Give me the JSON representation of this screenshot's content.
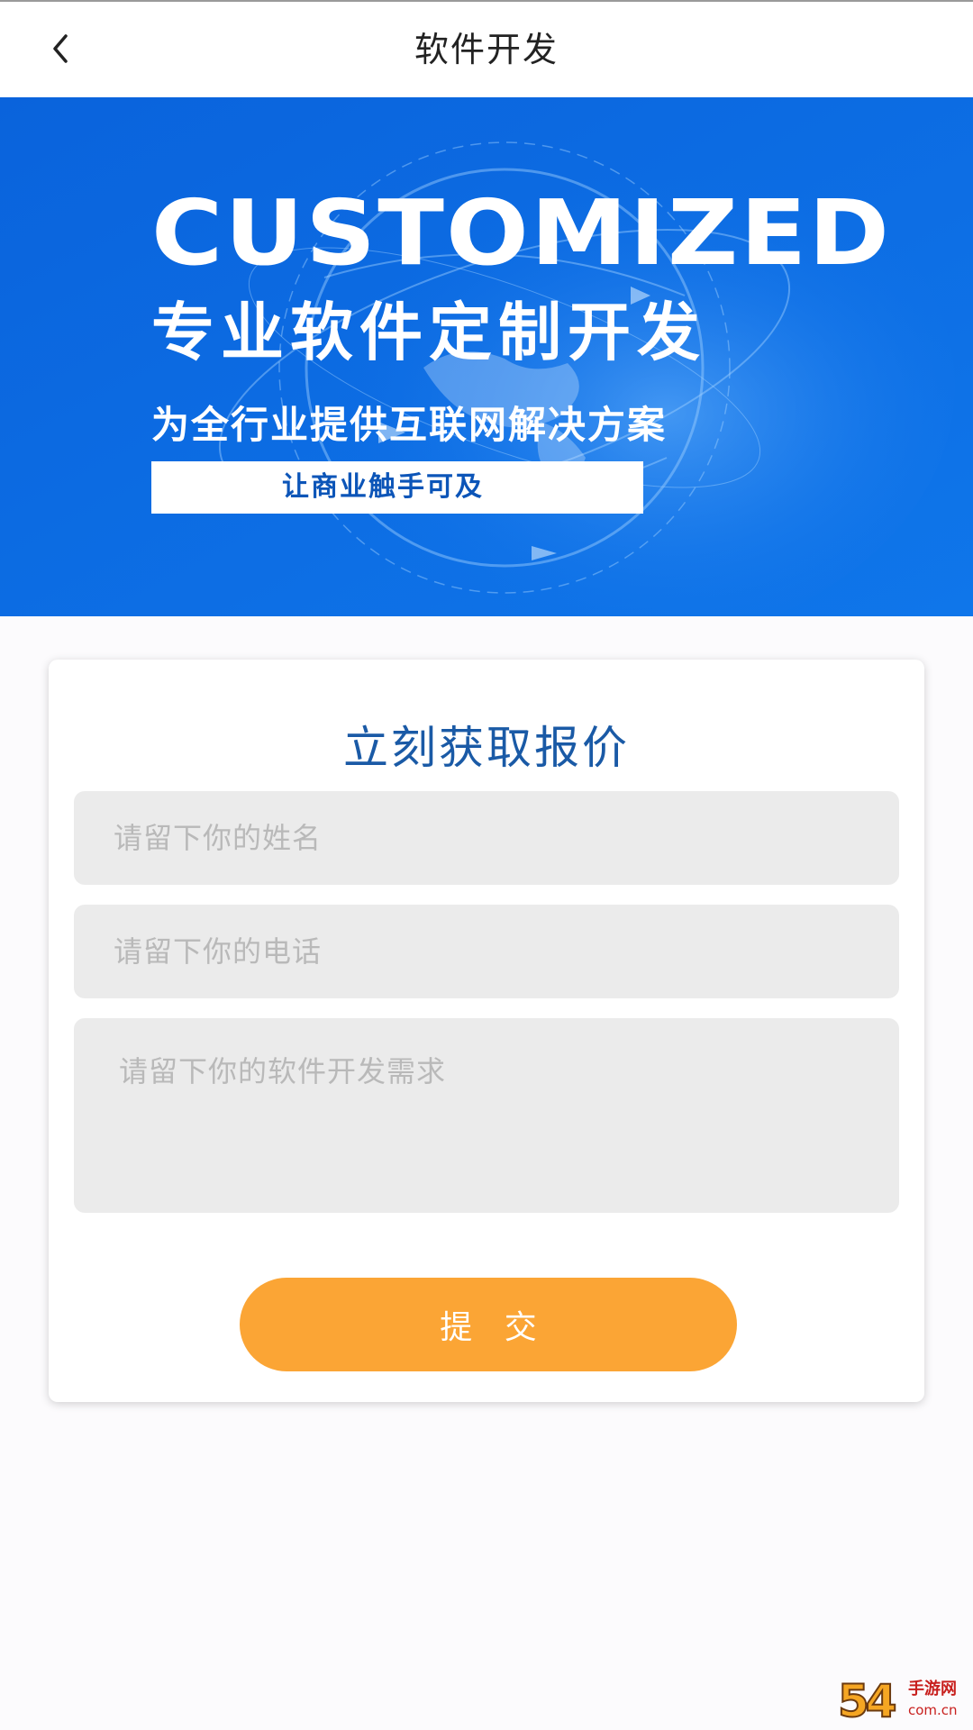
{
  "navbar": {
    "title": "软件开发",
    "back_icon": "chevron-left-icon"
  },
  "banner": {
    "heading": "CUSTOMIZED",
    "subheading": "专业软件定制开发",
    "tagline": "为全行业提供互联网解决方案",
    "slogan": "让商业触手可及",
    "background_color": "#0c6ee6"
  },
  "form": {
    "title": "立刻获取报价",
    "name_placeholder": "请留下你的姓名",
    "name_value": "",
    "phone_placeholder": "请留下你的电话",
    "phone_value": "",
    "requirement_placeholder": "请留下你的软件开发需求",
    "requirement_value": "",
    "submit_label": "提 交",
    "accent_color": "#fba535",
    "title_color": "#1a5aa6"
  },
  "watermark": {
    "logo_text": "54",
    "site_name": "手游网",
    "domain": "com.cn"
  }
}
